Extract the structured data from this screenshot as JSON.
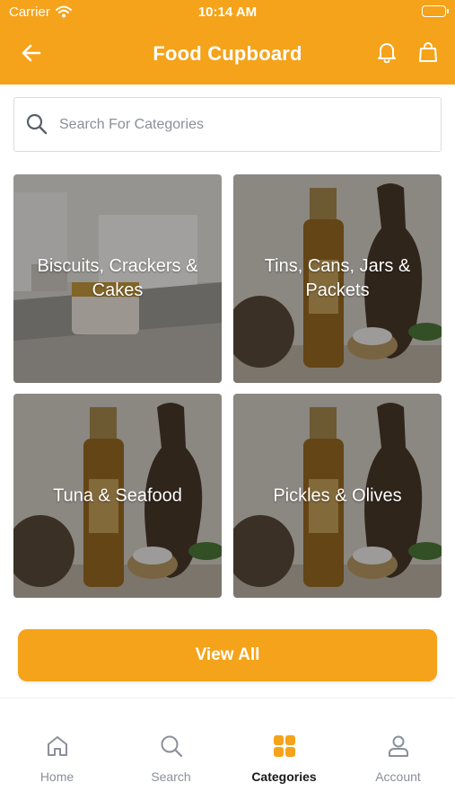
{
  "status_bar": {
    "carrier": "Carrier",
    "time": "10:14 AM"
  },
  "header": {
    "title": "Food Cupboard",
    "back_icon": "arrow-left-icon",
    "notification_icon": "bell-icon",
    "cart_icon": "shopping-bag-icon"
  },
  "search": {
    "placeholder": "Search For Categories",
    "value": "",
    "icon": "search-icon"
  },
  "categories": [
    {
      "label": "Biscuits, Crackers & Cakes"
    },
    {
      "label": "Tins, Cans, Jars & Packets"
    },
    {
      "label": "Tuna & Seafood"
    },
    {
      "label": "Pickles & Olives"
    }
  ],
  "view_all_label": "View All",
  "tab_bar": {
    "items": [
      {
        "label": "Home",
        "icon": "home-icon"
      },
      {
        "label": "Search",
        "icon": "search-icon"
      },
      {
        "label": "Categories",
        "icon": "grid-icon",
        "active": true
      },
      {
        "label": "Account",
        "icon": "user-icon"
      }
    ]
  },
  "colors": {
    "accent": "#F5A31A",
    "inactive": "#8A8F99",
    "active_text": "#1A1A1A"
  }
}
